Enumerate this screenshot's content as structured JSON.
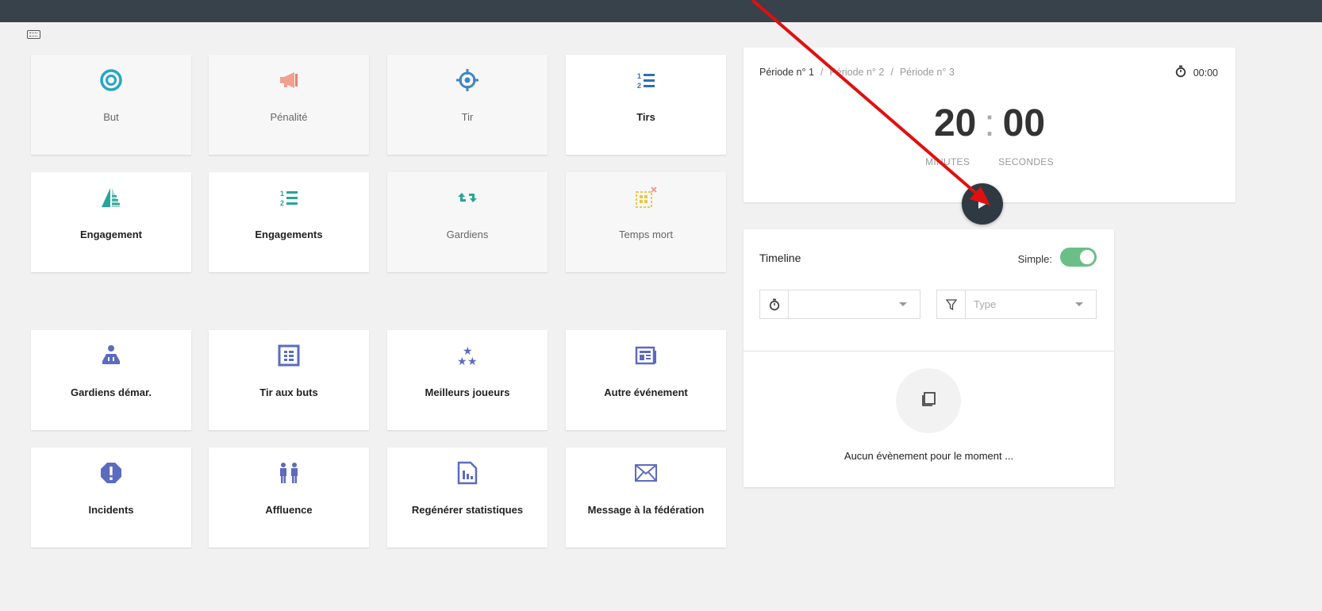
{
  "tiles": [
    {
      "label": "But",
      "icon": "target-icon",
      "dim": true
    },
    {
      "label": "Pénalité",
      "icon": "megaphone-icon",
      "dim": true
    },
    {
      "label": "Tir",
      "icon": "crosshair-icon",
      "dim": true
    },
    {
      "label": "Tirs",
      "icon": "numbered-list-icon",
      "dim": false
    },
    {
      "label": "Engagement",
      "icon": "faceoff-icon",
      "dim": false
    },
    {
      "label": "Engagements",
      "icon": "numbered-list-green-icon",
      "dim": false
    },
    {
      "label": "Gardiens",
      "icon": "swap-icon",
      "dim": true
    },
    {
      "label": "Temps mort",
      "icon": "timeout-icon",
      "dim": true
    },
    {
      "label": "Gardiens démar.",
      "icon": "goalie-icon",
      "dim": false
    },
    {
      "label": "Tir aux buts",
      "icon": "table-icon",
      "dim": false
    },
    {
      "label": "Meilleurs joueurs",
      "icon": "stars-icon",
      "dim": false
    },
    {
      "label": "Autre événement",
      "icon": "newspaper-icon",
      "dim": false
    },
    {
      "label": "Incidents",
      "icon": "alert-octagon-icon",
      "dim": false
    },
    {
      "label": "Affluence",
      "icon": "people-icon",
      "dim": false
    },
    {
      "label": "Regénérer statistiques",
      "icon": "report-chart-icon",
      "dim": false
    },
    {
      "label": "Message à la fédération",
      "icon": "envelope-icon",
      "dim": false
    }
  ],
  "timer": {
    "periods": [
      "Période n° 1",
      "Période n° 2",
      "Période n° 3"
    ],
    "separator": "/",
    "active_period": 0,
    "elapsed": "00:00",
    "minutes": "20",
    "colon": ":",
    "seconds": "00",
    "minutes_label": "MINUTES",
    "seconds_label": "SECONDES"
  },
  "timeline": {
    "title": "Timeline",
    "simple_label": "Simple:",
    "simple_on": true,
    "period_filter_value": "",
    "type_placeholder": "Type",
    "empty_message": "Aucun évènement pour le moment ..."
  },
  "colors": {
    "topbar": "#37424a",
    "accent_teal": "#26a69a",
    "accent_indigo": "#5c6bc0",
    "toggle_on": "#6bbf86",
    "annotation_arrow": "#e01010"
  }
}
